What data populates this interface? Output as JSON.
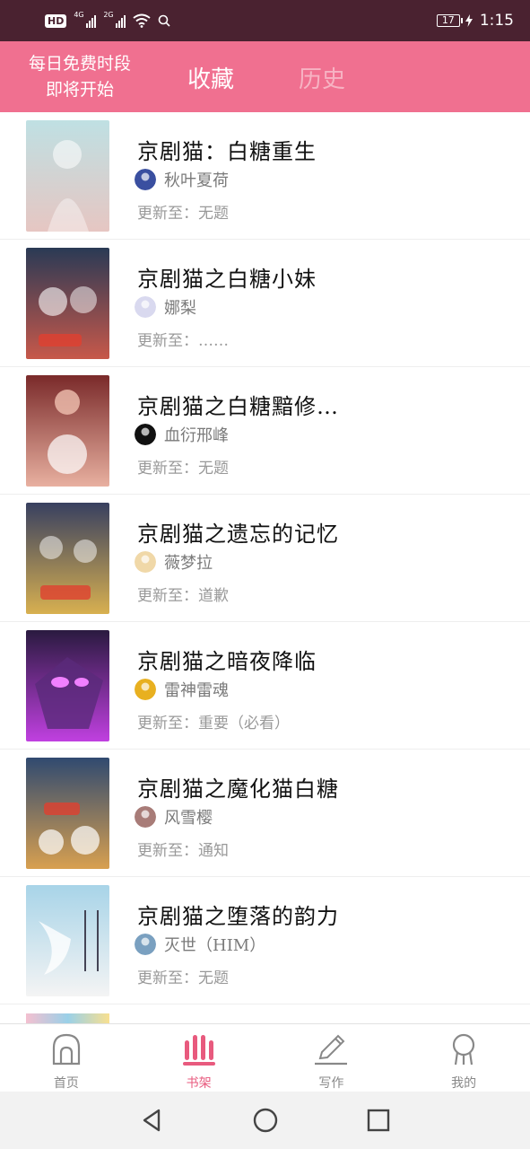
{
  "status_bar": {
    "hd": "HD",
    "net1": "4G",
    "net2": "2G",
    "battery": "17",
    "time": "1:15"
  },
  "header": {
    "promo_line1": "每日免费时段",
    "promo_line2": "即将开始",
    "tab_favorites": "收藏",
    "tab_history": "历史"
  },
  "books": [
    {
      "title": "京剧猫：白糖重生",
      "author": "秋叶夏荷",
      "update": "更新至：无题",
      "cover_colors": [
        "#bfe0e3",
        "#e6c6c2"
      ],
      "avatar_color": "#3a4fa0"
    },
    {
      "title": "京剧猫之白糖小妹",
      "author": "娜梨",
      "update": "更新至：……",
      "cover_colors": [
        "#2a3a55",
        "#c7584a"
      ],
      "avatar_color": "#d9d9ef"
    },
    {
      "title": "京剧猫之白糖黯修…",
      "author": "血衍邢峰",
      "update": "更新至：无题",
      "cover_colors": [
        "#7a2a2a",
        "#e8b0a0"
      ],
      "avatar_color": "#111111"
    },
    {
      "title": "京剧猫之遗忘的记忆",
      "author": "薇梦拉",
      "update": "更新至：道歉",
      "cover_colors": [
        "#384060",
        "#d8b050"
      ],
      "avatar_color": "#f0d8a8"
    },
    {
      "title": "京剧猫之暗夜降临",
      "author": "雷神雷魂",
      "update": "更新至：重要（必看）",
      "cover_colors": [
        "#2a1a40",
        "#c040e0"
      ],
      "avatar_color": "#e8b020"
    },
    {
      "title": "京剧猫之魔化猫白糖",
      "author": "风雪樱",
      "update": "更新至：通知",
      "cover_colors": [
        "#304a70",
        "#d8a050"
      ],
      "avatar_color": "#a87c78"
    },
    {
      "title": "京剧猫之堕落的韵力",
      "author": "灭世（HIM）",
      "update": "更新至：无题",
      "cover_colors": [
        "#a8d4e8",
        "#f4f4f4"
      ],
      "avatar_color": "#7aa0c0"
    }
  ],
  "bottom_nav": [
    {
      "label": "首页",
      "icon": "home-icon",
      "active": false
    },
    {
      "label": "书架",
      "icon": "bookshelf-icon",
      "active": true
    },
    {
      "label": "写作",
      "icon": "pencil-icon",
      "active": false
    },
    {
      "label": "我的",
      "icon": "profile-icon",
      "active": false
    }
  ],
  "colors": {
    "header_pink": "#f07090",
    "active_pink": "#e85a7e",
    "status_bar": "#4a2230"
  }
}
